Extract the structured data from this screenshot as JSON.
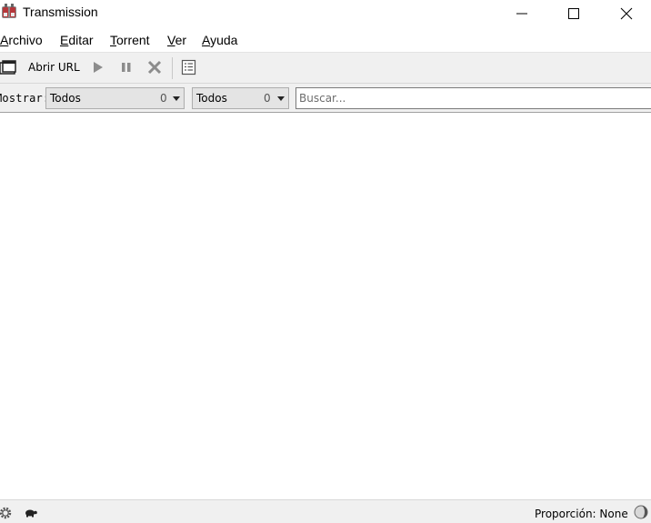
{
  "window": {
    "title": "Transmission",
    "icon": "transmission-app-icon",
    "controls": [
      "minimize",
      "maximize",
      "close"
    ]
  },
  "menu": {
    "file": {
      "accel": "A",
      "rest": "rchivo"
    },
    "edit": {
      "accel": "E",
      "rest": "ditar"
    },
    "torrent": {
      "accel": "T",
      "rest": "orrent"
    },
    "view": {
      "accel": "V",
      "rest": "er"
    },
    "help": {
      "accel": "A",
      "rest": "yuda"
    }
  },
  "toolbar": {
    "open_icon": "open-folder-icon",
    "open_url_label": "Abrir URL",
    "start_icon": "play-icon",
    "pause_icon": "pause-icon",
    "remove_icon": "remove-x-icon",
    "properties_icon": "properties-list-icon"
  },
  "filter": {
    "show_label": "Mostrar:",
    "activity": {
      "value": "Todos",
      "count": "0"
    },
    "tracker": {
      "value": "Todos",
      "count": "0"
    },
    "search_placeholder": "Buscar..."
  },
  "torrents": [],
  "statusbar": {
    "options_icon": "gear-icon",
    "speed_limit_icon": "turtle-icon",
    "ratio_label": "Proporción: None",
    "ratio_icon": "ratio-circle-icon"
  },
  "colors": {
    "chrome_bg": "#f0f0f0",
    "content_bg": "#ffffff",
    "combo_bg": "#e4e4e4",
    "app_icon_red": "#b5373a"
  }
}
